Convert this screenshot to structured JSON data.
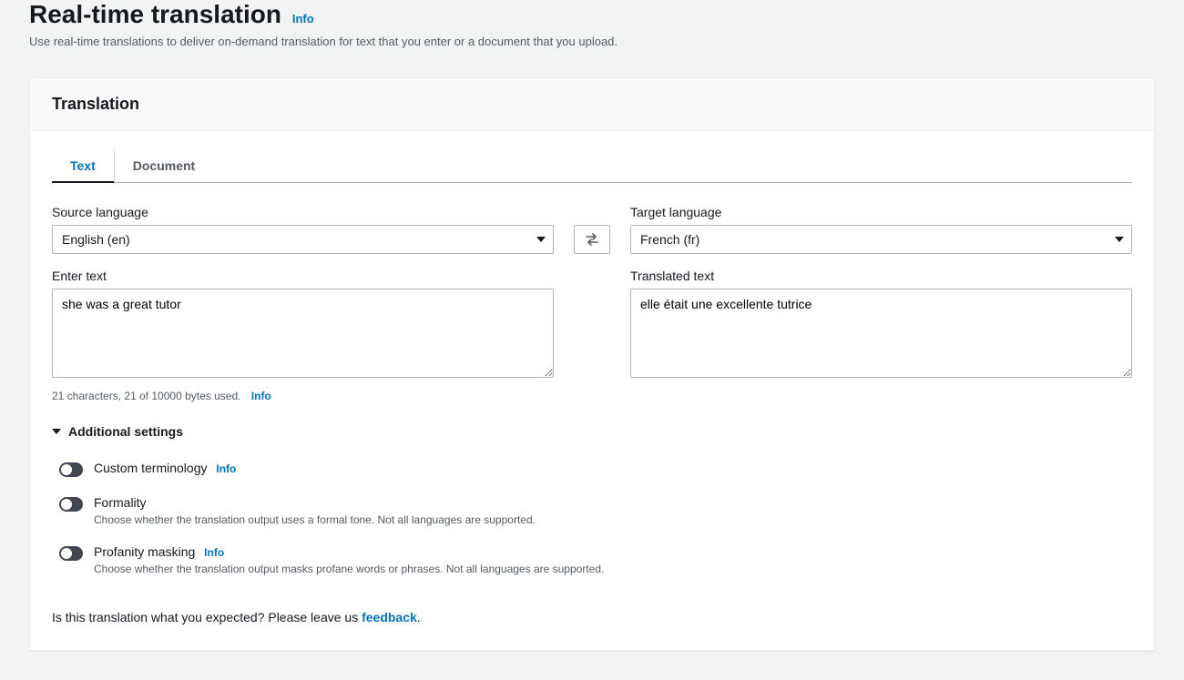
{
  "header": {
    "title": "Real-time translation",
    "info": "Info",
    "description": "Use real-time translations to deliver on-demand translation for text that you enter or a document that you upload."
  },
  "panel": {
    "title": "Translation"
  },
  "tabs": [
    {
      "label": "Text",
      "active": true
    },
    {
      "label": "Document",
      "active": false
    }
  ],
  "source": {
    "label": "Source language",
    "value": "English (en)",
    "textLabel": "Enter text",
    "textValue": "she was a great tutor"
  },
  "target": {
    "label": "Target language",
    "value": "French (fr)",
    "textLabel": "Translated text",
    "textValue": "elle était une excellente tutrice"
  },
  "counter": {
    "text": "21 characters, 21 of 10000 bytes used.",
    "info": "Info"
  },
  "additional": {
    "title": "Additional settings",
    "settings": [
      {
        "label": "Custom terminology",
        "info": "Info",
        "desc": ""
      },
      {
        "label": "Formality",
        "info": "",
        "desc": "Choose whether the translation output uses a formal tone. Not all languages are supported."
      },
      {
        "label": "Profanity masking",
        "info": "Info",
        "desc": "Choose whether the translation output masks profane words or phrases. Not all languages are supported."
      }
    ]
  },
  "feedback": {
    "prefix": "Is this translation what you expected? Please leave us ",
    "link": "feedback",
    "suffix": "."
  }
}
